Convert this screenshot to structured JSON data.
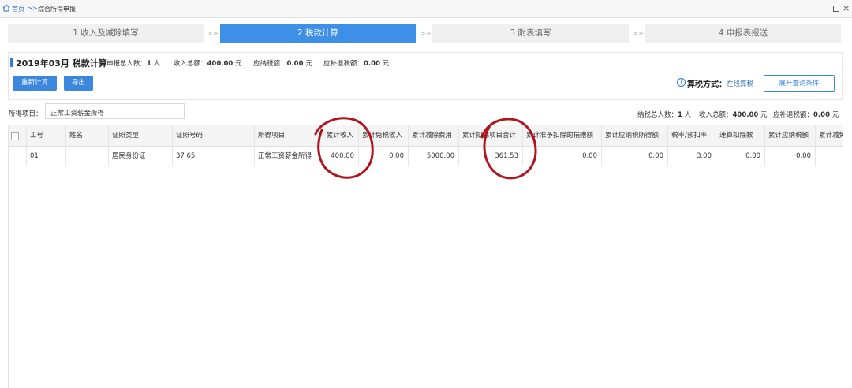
{
  "breadcrumb": {
    "home": "首页",
    "separator": ">>",
    "current": "综合所得申报"
  },
  "steps": [
    {
      "label": "1 收入及减除填写",
      "active": false
    },
    {
      "label": "2 税款计算",
      "active": true
    },
    {
      "label": "3 附表填写",
      "active": false
    },
    {
      "label": "4 申报表报送",
      "active": false
    }
  ],
  "step_arrow": ">>",
  "panel": {
    "period": "2019年03月 税款计算",
    "stats": [
      {
        "label": "申报总人数：",
        "value": "1",
        "unit": " 人"
      },
      {
        "label": "收入总额：",
        "value": "400.00",
        "unit": " 元"
      },
      {
        "label": "应纳税额：",
        "value": "0.00",
        "unit": " 元"
      },
      {
        "label": "应补退税额：",
        "value": "0.00",
        "unit": " 元"
      }
    ],
    "recalc_button": "重新计算",
    "export_button": "导出",
    "info_glyph": "i",
    "method_label": "算税方式：",
    "method_value": "在线算税",
    "expand_button": "展开查询条件"
  },
  "filter": {
    "label": "所得项目：",
    "selected": "正常工资薪金所得"
  },
  "summary": {
    "taxpayers_label": "纳税总人数：",
    "taxpayers_value": "1",
    "taxpayers_unit": " 人",
    "income_label": "收入总额：",
    "income_value": "400.00",
    "income_unit": " 元",
    "refund_label": "应补退税额：",
    "refund_value": "0.00",
    "refund_unit": " 元"
  },
  "table": {
    "columns": [
      "工号",
      "姓名",
      "证照类型",
      "证照号码",
      "所得项目",
      "累计收入",
      "累计免税收入",
      "累计减除费用",
      "累计扣除项目合计",
      "累计准予扣除的捐赠额",
      "累计应纳税所得额",
      "税率/预扣率",
      "速算扣除数",
      "累计应纳税额",
      "累计减免税额"
    ],
    "rows": [
      [
        "01",
        "",
        "居民身份证",
        "37          65",
        "正常工资薪金所得",
        "400.00",
        "0.00",
        "5000.00",
        "361.53",
        "0.00",
        "0.00",
        "3.00",
        "0.00",
        "0.00",
        ""
      ]
    ]
  },
  "colors": {
    "accent": "#3d8fe8",
    "annotation": "#b0141c"
  }
}
